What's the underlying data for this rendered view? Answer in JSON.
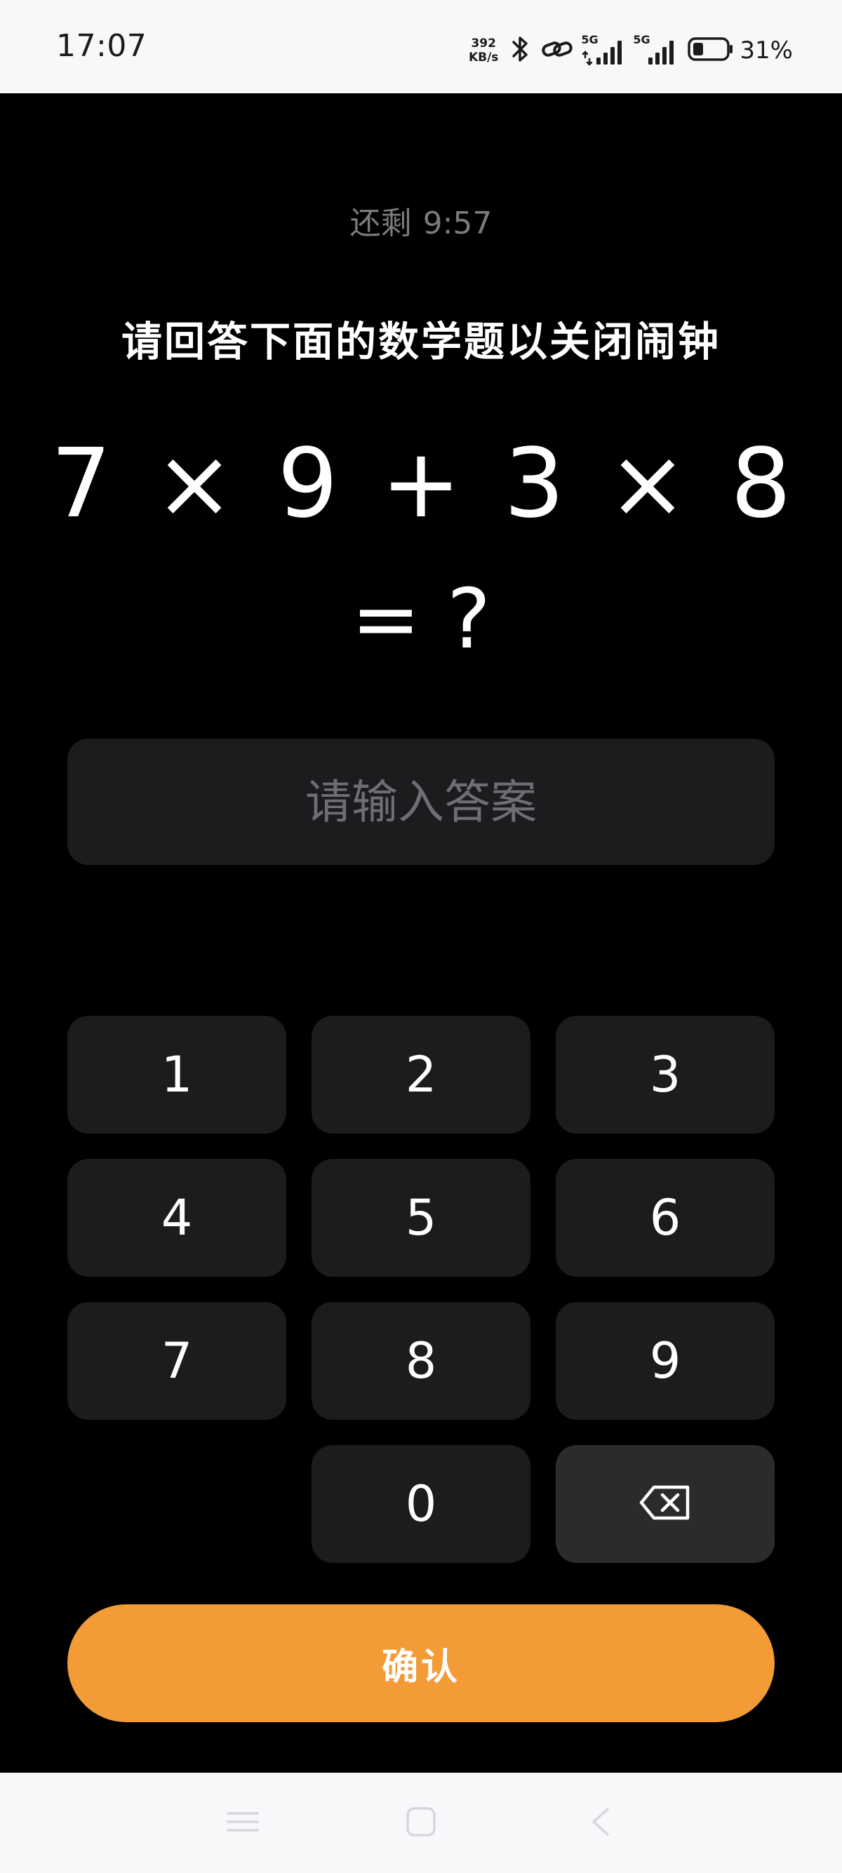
{
  "status_bar": {
    "time": "17:07",
    "net_speed_value": "392",
    "net_speed_unit": "KB/s",
    "signal_1_label": "5G",
    "signal_2_label": "5G",
    "battery_percent": "31%",
    "battery_level": 0.31
  },
  "countdown": {
    "label": "还剩",
    "time": "9:57"
  },
  "instruction": "请回答下面的数学题以关闭闹钟",
  "problem": {
    "expression": "7 × 9 + 3 × 8",
    "result": "= ?"
  },
  "answer_input": {
    "placeholder": "请输入答案",
    "value": ""
  },
  "keypad": {
    "keys": [
      "1",
      "2",
      "3",
      "4",
      "5",
      "6",
      "7",
      "8",
      "9",
      "0"
    ],
    "backspace_icon": "backspace-icon"
  },
  "confirm_button": "确认",
  "colors": {
    "background": "#000000",
    "key_background": "#1c1c1e",
    "accent": "#f29b37",
    "muted_text": "#7b7b7f"
  },
  "nav_bar": {
    "icons": [
      "menu-icon",
      "home-icon",
      "back-icon"
    ]
  }
}
